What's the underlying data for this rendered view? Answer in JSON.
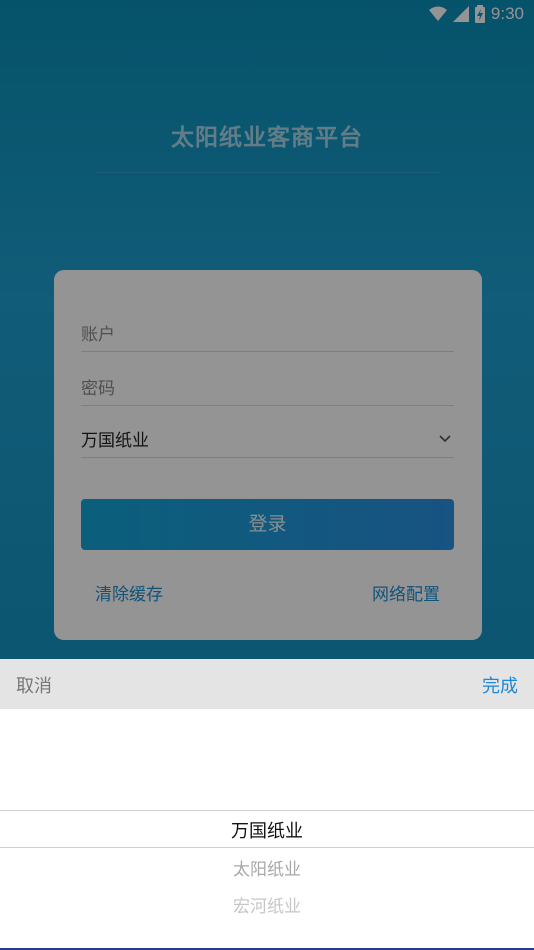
{
  "status_bar": {
    "time": "9:30",
    "icons": [
      "wifi-icon",
      "cell-signal-icon",
      "battery-charging-icon"
    ]
  },
  "app": {
    "title": "太阳纸业客商平台",
    "form": {
      "account_placeholder": "账户",
      "password_placeholder": "密码",
      "company_value": "万国纸业",
      "login_label": "登录",
      "clear_cache_label": "清除缓存",
      "network_config_label": "网络配置"
    }
  },
  "picker": {
    "cancel_label": "取消",
    "done_label": "完成",
    "options": [
      "万国纸业",
      "太阳纸业",
      "宏河纸业"
    ],
    "selected": "万国纸业"
  },
  "colors": {
    "accent": "#1e88d8",
    "background_top": "#0a8fb8"
  }
}
